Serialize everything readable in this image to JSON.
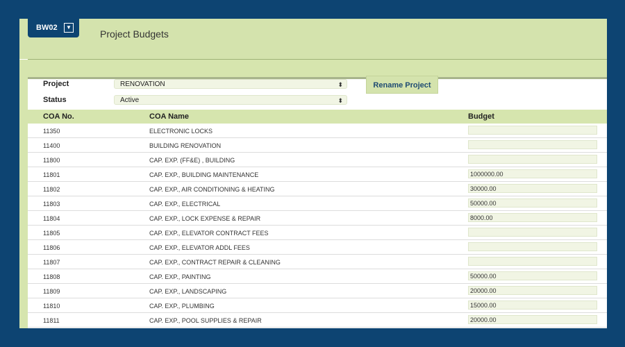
{
  "tab": {
    "code": "BW02",
    "dropdown_glyph": "▼"
  },
  "page": {
    "title": "Project Budgets"
  },
  "form": {
    "project_label": "Project",
    "project_value": "RENOVATION",
    "status_label": "Status",
    "status_value": "Active",
    "select_arrows": "⬍",
    "rename_button": "Rename Project"
  },
  "table": {
    "headers": {
      "coa_no": "COA No.",
      "coa_name": "COA Name",
      "budget": "Budget"
    },
    "rows": [
      {
        "no": "11350",
        "name": "ELECTRONIC LOCKS",
        "budget": ""
      },
      {
        "no": "11400",
        "name": "BUILDING RENOVATION",
        "budget": ""
      },
      {
        "no": "11800",
        "name": "CAP. EXP. (FF&E) , BUILDING",
        "budget": ""
      },
      {
        "no": "11801",
        "name": "CAP. EXP., BUILDING MAINTENANCE",
        "budget": "1000000.00"
      },
      {
        "no": "11802",
        "name": "CAP. EXP., AIR CONDITIONING & HEATING",
        "budget": "30000.00"
      },
      {
        "no": "11803",
        "name": "CAP. EXP., ELECTRICAL",
        "budget": "50000.00"
      },
      {
        "no": "11804",
        "name": "CAP. EXP., LOCK EXPENSE & REPAIR",
        "budget": "8000.00"
      },
      {
        "no": "11805",
        "name": "CAP. EXP., ELEVATOR CONTRACT FEES",
        "budget": ""
      },
      {
        "no": "11806",
        "name": "CAP. EXP., ELEVATOR ADDL FEES",
        "budget": ""
      },
      {
        "no": "11807",
        "name": "CAP. EXP., CONTRACT REPAIR & CLEANING",
        "budget": ""
      },
      {
        "no": "11808",
        "name": "CAP. EXP., PAINTING",
        "budget": "50000.00"
      },
      {
        "no": "11809",
        "name": "CAP. EXP., LANDSCAPING",
        "budget": "20000.00"
      },
      {
        "no": "11810",
        "name": "CAP. EXP., PLUMBING",
        "budget": "15000.00"
      },
      {
        "no": "11811",
        "name": "CAP. EXP., POOL SUPPLIES & REPAIR",
        "budget": "20000.00"
      }
    ]
  }
}
